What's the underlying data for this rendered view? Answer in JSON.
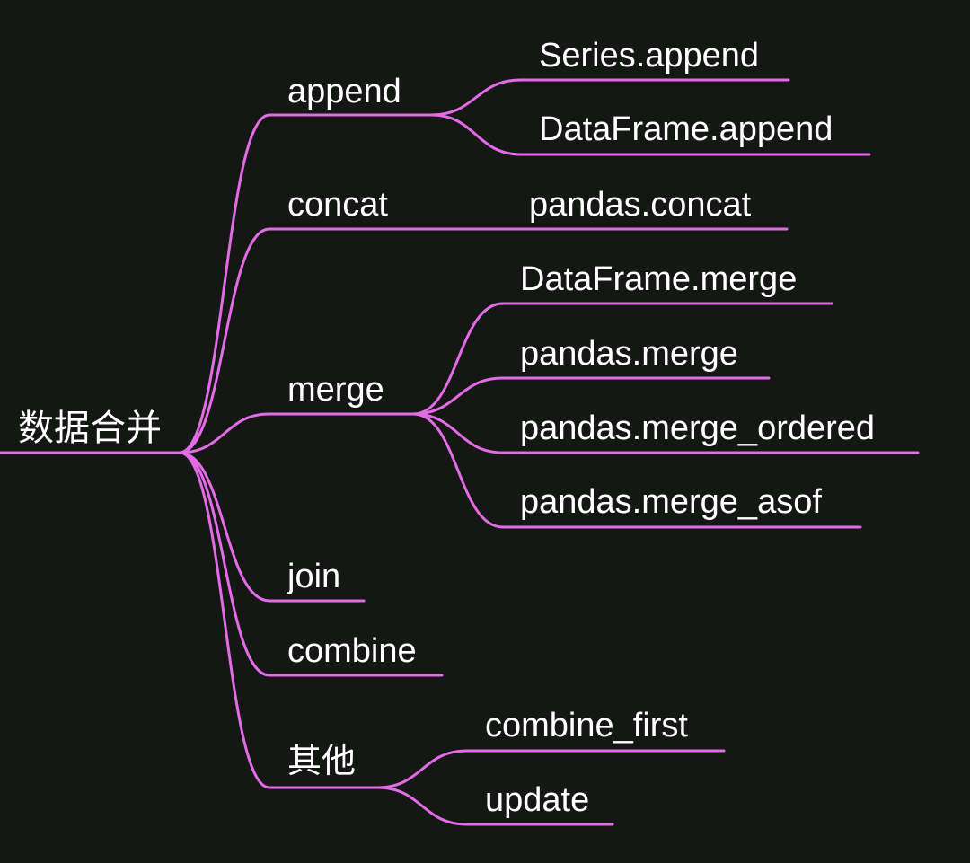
{
  "theme": {
    "background": "#141714",
    "line_color": "#e46be6",
    "text_color": "#ffffff"
  },
  "mindmap": {
    "root": {
      "label": "数据合并",
      "children": [
        {
          "label": "append",
          "children": [
            {
              "label": "Series.append"
            },
            {
              "label": "DataFrame.append"
            }
          ]
        },
        {
          "label": "concat",
          "children": [
            {
              "label": "pandas.concat"
            }
          ]
        },
        {
          "label": "merge",
          "children": [
            {
              "label": "DataFrame.merge"
            },
            {
              "label": "pandas.merge"
            },
            {
              "label": "pandas.merge_ordered"
            },
            {
              "label": "pandas.merge_asof"
            }
          ]
        },
        {
          "label": "join",
          "children": []
        },
        {
          "label": "combine",
          "children": []
        },
        {
          "label": "其他",
          "children": [
            {
              "label": "combine_first"
            },
            {
              "label": "update"
            }
          ]
        }
      ]
    }
  }
}
